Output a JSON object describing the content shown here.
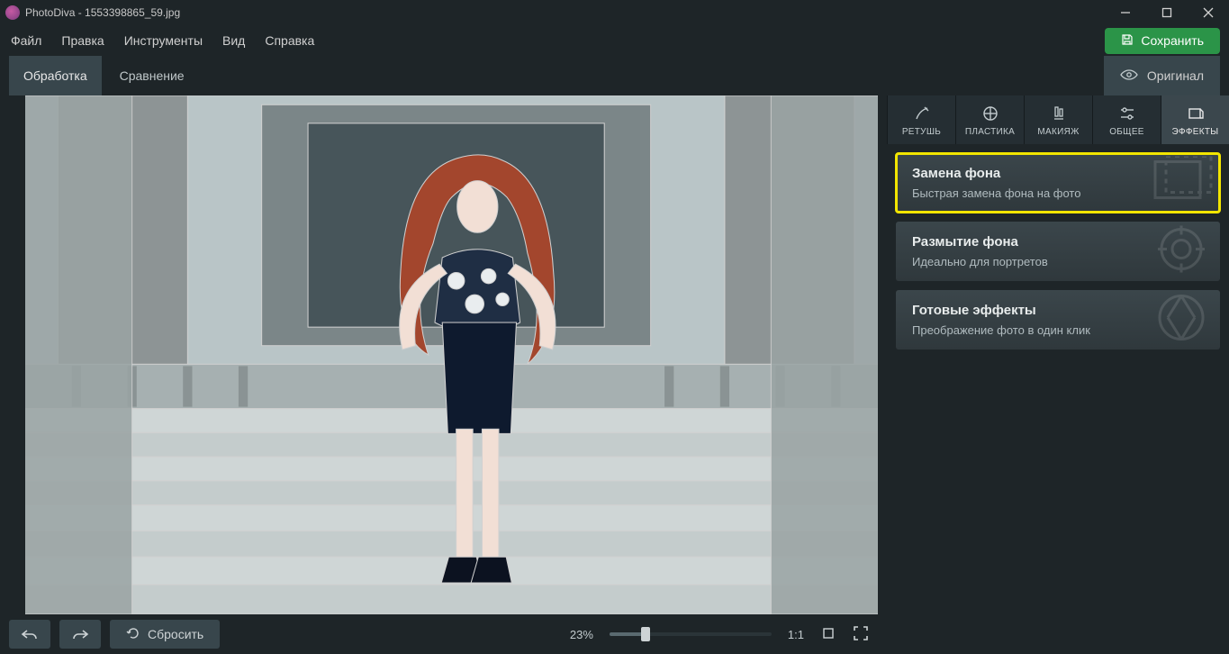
{
  "window": {
    "title": "PhotoDiva - 1553398865_59.jpg"
  },
  "menu": {
    "items": [
      "Файл",
      "Правка",
      "Инструменты",
      "Вид",
      "Справка"
    ],
    "save": "Сохранить"
  },
  "view_tabs": {
    "processing": "Обработка",
    "compare": "Сравнение",
    "original": "Оригинал"
  },
  "tool_tabs": [
    {
      "id": "retouch",
      "label": "РЕТУШЬ"
    },
    {
      "id": "plastic",
      "label": "ПЛАСТИКА"
    },
    {
      "id": "makeup",
      "label": "МАКИЯЖ"
    },
    {
      "id": "general",
      "label": "ОБЩЕЕ"
    },
    {
      "id": "effects",
      "label": "ЭФФЕКТЫ"
    }
  ],
  "effects": [
    {
      "title": "Замена фона",
      "subtitle": "Быстрая замена фона на фото",
      "highlight": true
    },
    {
      "title": "Размытие фона",
      "subtitle": "Идеально для портретов",
      "highlight": false
    },
    {
      "title": "Готовые эффекты",
      "subtitle": "Преображение фото в один клик",
      "highlight": false
    }
  ],
  "bottom": {
    "reset": "Сбросить",
    "zoom": "23%",
    "ratio": "1:1"
  }
}
